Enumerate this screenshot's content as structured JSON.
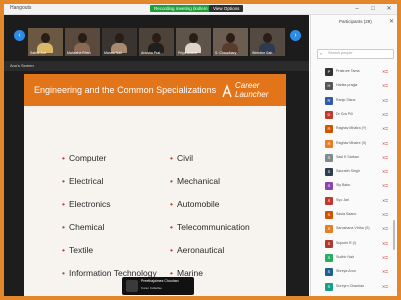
{
  "window": {
    "title": "Hangouts",
    "minimize": "–",
    "maximize": "□",
    "close": "✕"
  },
  "meeting": {
    "recording_badge": "Recording meeting (kollem Hate Cam)",
    "view_options": "View Options"
  },
  "nav": {
    "prev": "‹",
    "next": "›"
  },
  "participants_strip": [
    {
      "name": "Sabile Ant",
      "bg": "#6b5843",
      "shirt": "#d9b86a"
    },
    {
      "name": "Mahasha Bhan",
      "bg": "#5a4a3d",
      "shirt": "#8a6a55"
    },
    {
      "name": "Manda Nair",
      "bg": "#3a3430",
      "shirt": "#a88a70"
    },
    {
      "name": "Anusha Pral",
      "bg": "#4d4338",
      "shirt": "#1f1f1f"
    },
    {
      "name": "Priya Anand",
      "bg": "#5f544a",
      "shirt": "#e0d3c8"
    },
    {
      "name": "S. Chaudhary",
      "bg": "#6b5d4f",
      "shirt": "#5a3c2e"
    },
    {
      "name": "Wrenthe Sah",
      "bg": "#544a42",
      "shirt": "#2e3a4d"
    }
  ],
  "share": {
    "label": "Anu's Screen"
  },
  "slide": {
    "title": "Engineering and the Common Specializations",
    "logo_line1": "Career",
    "logo_line2": "Launcher",
    "left_items": [
      "Computer",
      "Electrical",
      "Electronics",
      "Chemical",
      "Textile",
      "Information Technology"
    ],
    "right_items": [
      "Civil",
      "Mechanical",
      "Automobile",
      "Telecommunication",
      "Aeronautical",
      "Marine"
    ],
    "bullet": "•"
  },
  "speaker": {
    "name": "Preethajaimes Chouhan",
    "sub": "Kuran Collarfae"
  },
  "panel": {
    "title": "Participants (29)",
    "close": "✕",
    "search_placeholder": "Search people",
    "people": [
      {
        "initial": "P",
        "name": "Prakrure Tama",
        "color": "#333333",
        "icons": "🎙 🔲"
      },
      {
        "initial": "H",
        "name": "Harika pragla",
        "color": "#555555",
        "icons": "🎙 🔲"
      },
      {
        "initial": "R",
        "name": "Ranjo Sisna",
        "color": "#2f5aa8",
        "icons": "🎙 🔲"
      },
      {
        "initial": "D",
        "name": "Dr Gra Pili",
        "color": "#c0392b",
        "icons": "🎙 🔲"
      },
      {
        "initial": "R",
        "name": "Raghav Mhatra (Y)",
        "color": "#d35400",
        "icons": "🎙 🔲"
      },
      {
        "initial": "R",
        "name": "Raghav Mhatre (II)",
        "color": "#e67e22",
        "icons": "🎙 🔲"
      },
      {
        "initial": "S",
        "name": "Sasi K Sarkan",
        "color": "#7f8c8d",
        "icons": "🎙 🔲"
      },
      {
        "initial": "S",
        "name": "Saurabh Singh",
        "color": "#2c3e50",
        "icons": "🎙 🔲"
      },
      {
        "initial": "S",
        "name": "Sly Babu",
        "color": "#8e44ad",
        "icons": "🎙 🔲"
      },
      {
        "initial": "S",
        "name": "Syo Jari",
        "color": "#c0392b",
        "icons": "🎙 🔲"
      },
      {
        "initial": "S",
        "name": "Savia Saanu",
        "color": "#d35400",
        "icons": "🎙 🔲"
      },
      {
        "initial": "S",
        "name": "Saroshana Vhtha (S)",
        "color": "#e67e22",
        "icons": "🎙 🔲"
      },
      {
        "initial": "S",
        "name": "Sujoohi R (I)",
        "color": "#b03a2e",
        "icons": "🎙 🔲"
      },
      {
        "initial": "S",
        "name": "Sudhir Nair",
        "color": "#27ae60",
        "icons": "🎙 🔲"
      },
      {
        "initial": "S",
        "name": "Shreya Arun",
        "color": "#1f618d",
        "icons": "🎙 🔲"
      },
      {
        "initial": "S",
        "name": "Sureyrn Chauhan",
        "color": "#16a085",
        "icons": "🎙 🔲"
      }
    ]
  }
}
